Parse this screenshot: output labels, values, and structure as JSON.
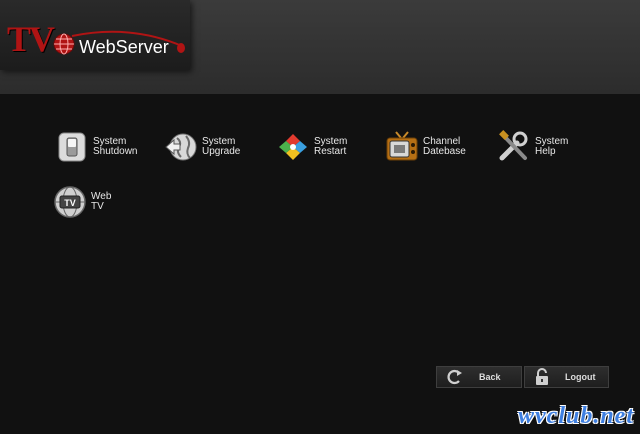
{
  "header": {
    "logo_tv": "TV",
    "logo_text": "WebServer"
  },
  "menu": [
    {
      "line1": "System",
      "line2": "Shutdown",
      "icon": "power-switch-icon"
    },
    {
      "line1": "System",
      "line2": "Upgrade",
      "icon": "globe-upgrade-icon"
    },
    {
      "line1": "System",
      "line2": "Restart",
      "icon": "restart-diamond-icon"
    },
    {
      "line1": "Channel",
      "line2": "Datebase",
      "icon": "retro-tv-icon"
    },
    {
      "line1": "System",
      "line2": "Help",
      "icon": "tools-icon"
    },
    {
      "line1": "Web",
      "line2": "TV",
      "icon": "web-tv-globe-icon"
    }
  ],
  "buttons": {
    "back": "Back",
    "logout": "Logout"
  },
  "watermark": "wvclub.net",
  "colors": {
    "logo_red": "#b01414",
    "header_bg": "#333333",
    "body_bg": "#111111",
    "watermark_blue": "#3f7fe0"
  }
}
